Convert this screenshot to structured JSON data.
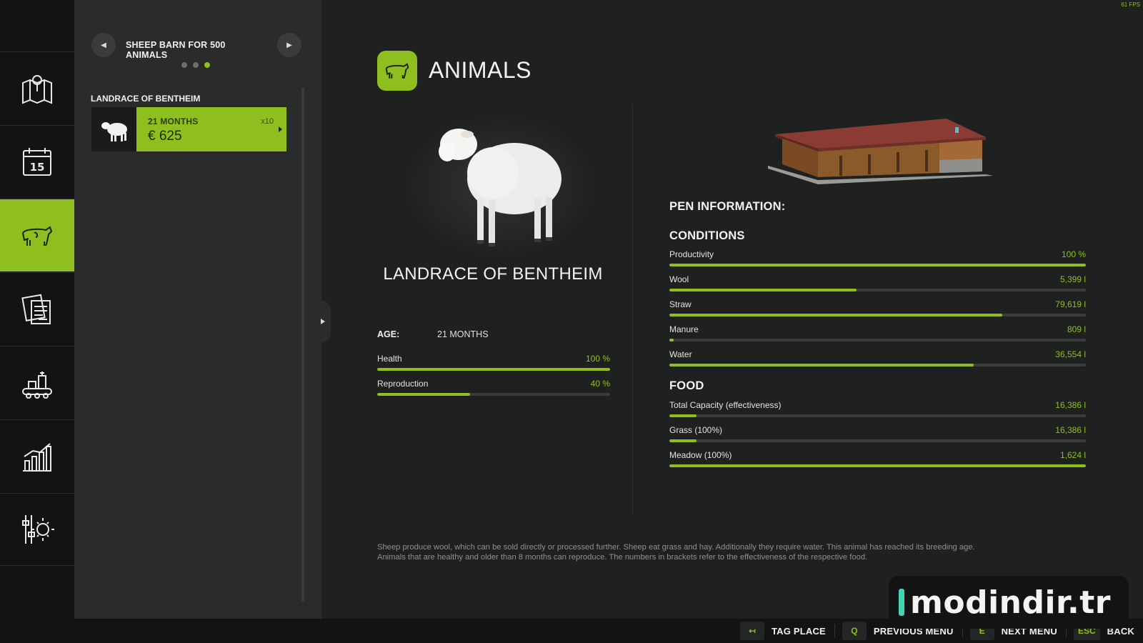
{
  "fps": "61 FPS",
  "colors": {
    "accent": "#8fbf1e",
    "background": "#1f2020",
    "rail": "#121313"
  },
  "rail": {
    "items": [
      {
        "icon": "map-icon",
        "active": false
      },
      {
        "icon": "calendar-icon",
        "label": "15",
        "active": false
      },
      {
        "icon": "animals-icon",
        "active": true
      },
      {
        "icon": "contracts-icon",
        "active": false
      },
      {
        "icon": "production-icon",
        "active": false
      },
      {
        "icon": "statistics-icon",
        "active": false
      },
      {
        "icon": "settings-icon",
        "active": false
      }
    ]
  },
  "panel": {
    "barn_title": "SHEEP BARN FOR 500 ANIMALS",
    "page_dots": 3,
    "active_dot": 3,
    "group_label": "LANDRACE OF BENTHEIM",
    "animal_card": {
      "age": "21 MONTHS",
      "count": "x10",
      "price": "€ 625"
    }
  },
  "main": {
    "title": "ANIMALS",
    "breed_name": "LANDRACE OF BENTHEIM",
    "age_label": "AGE:",
    "age_value": "21 MONTHS",
    "animal_stats": [
      {
        "label": "Health",
        "value": "100 %",
        "fill": 1.0
      },
      {
        "label": "Reproduction",
        "value": "40 %",
        "fill": 0.4
      }
    ],
    "pen_info_heading": "PEN INFORMATION:",
    "conditions_heading": "CONDITIONS",
    "conditions": [
      {
        "label": "Productivity",
        "value": "100 %",
        "fill": 1.0
      },
      {
        "label": "Wool",
        "value": "5,399 l",
        "fill": 0.45
      },
      {
        "label": "Straw",
        "value": "79,619 l",
        "fill": 0.8
      },
      {
        "label": "Manure",
        "value": "809 l",
        "fill": 0.01
      },
      {
        "label": "Water",
        "value": "36,554 l",
        "fill": 0.73
      }
    ],
    "food_heading": "FOOD",
    "food": [
      {
        "label": "Total Capacity (effectiveness)",
        "value": "16,386 l",
        "fill": 0.065
      },
      {
        "label": "Grass (100%)",
        "value": "16,386 l",
        "fill": 0.065
      },
      {
        "label": "Meadow (100%)",
        "value": "1,624 l",
        "fill": 1.0
      }
    ],
    "description_line1": "Sheep produce wool, which can be sold directly or processed further. Sheep eat grass and hay. Additionally they require water. This animal has reached its breeding age.",
    "description_line2": "Animals that are healthy and older than 8 months can reproduce. The numbers in brackets refer to the effectiveness of the respective food."
  },
  "footer": {
    "hints": [
      {
        "key": "↤",
        "label": "TAG PLACE"
      },
      {
        "key": "Q",
        "label": "PREVIOUS MENU"
      },
      {
        "key": "E",
        "label": "NEXT MENU"
      },
      {
        "key": "ESC",
        "label": "BACK"
      }
    ]
  },
  "watermark": "modindir.tr"
}
